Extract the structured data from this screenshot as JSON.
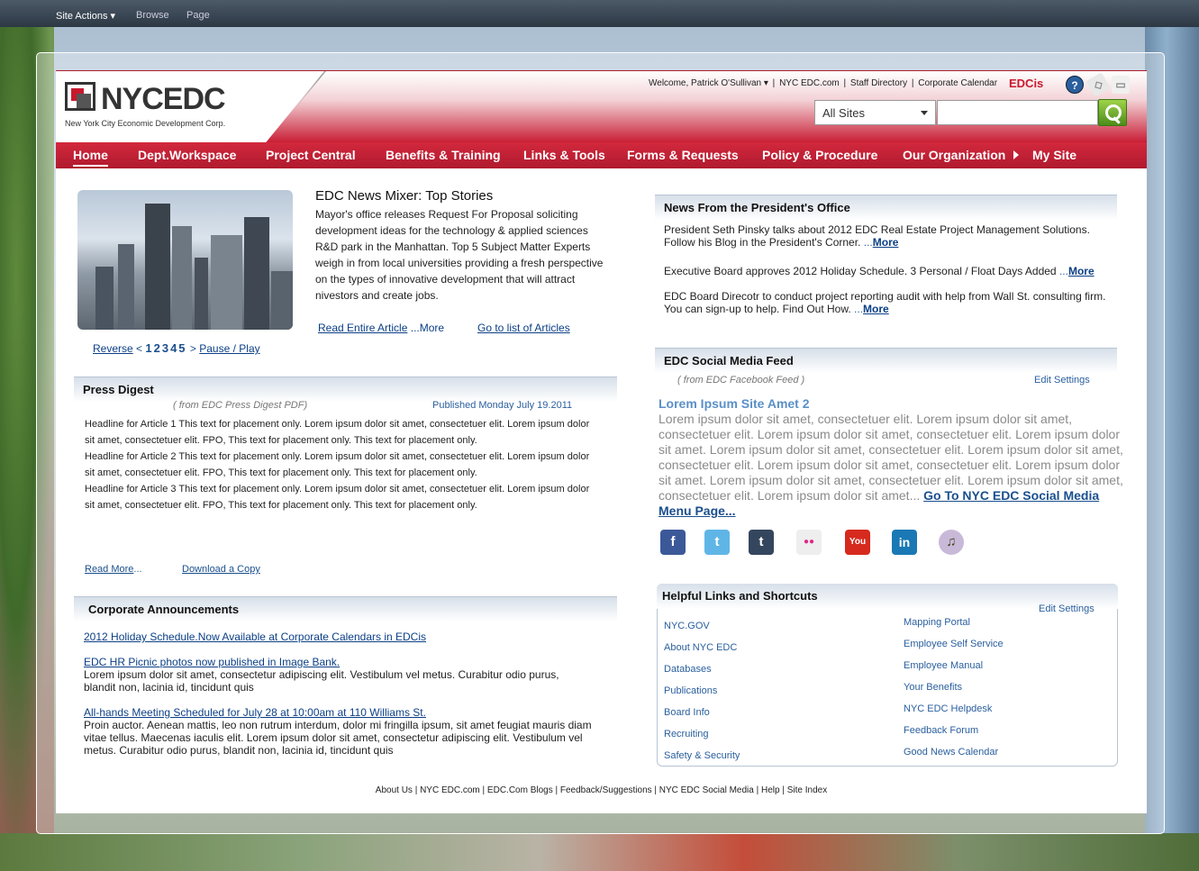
{
  "ribbon": {
    "site_actions": "Site Actions ▾",
    "browse": "Browse",
    "page": "Page"
  },
  "header": {
    "logo_text": "NYCEDC",
    "logo_sub": "New York City Economic Development Corp.",
    "welcome": "Welcome, Patrick O'Sullivan ▾",
    "links": [
      "NYC EDC.com",
      "Staff Directory",
      "Corporate Calendar"
    ],
    "edcis": "EDCis",
    "help_icon": "?",
    "scope": "All Sites",
    "search_placeholder": ""
  },
  "nav": [
    "Home",
    "Dept.Workspace",
    "Project Central",
    "Benefits & Training",
    "Links & Tools",
    "Forms & Requests",
    "Policy & Procedure",
    "Our Organization",
    "My Site"
  ],
  "news": {
    "title": "EDC News Mixer: Top Stories",
    "body": "Mayor's office releases Request For Proposal soliciting development ideas for the technology & applied sciences R&D park in the Manhattan. Top 5 Subject Matter Experts weigh in from local universities providing a fresh perspective on the types of innovative development that will attract nivestors and create jobs.",
    "read": "Read Entire Article",
    "more": "...More",
    "list": "Go to list of Articles",
    "reverse": "Reverse",
    "lt": "<",
    "pages": "12345",
    "gt": ">",
    "pause": "Pause / Play"
  },
  "press": {
    "title": "Press Digest",
    "source": "( from EDC Press Digest PDF)",
    "published": "Published Monday July 19.2011",
    "articles": [
      "Headline for Article 1 This text for placement only. Lorem ipsum dolor sit amet, consectetuer elit. Lorem ipsum dolor sit amet, consectetuer elit. FPO, This text for placement only. This text for placement only.",
      "Headline for Article 2 This text for placement only. Lorem ipsum dolor sit amet, consectetuer elit. Lorem ipsum dolor sit amet, consectetuer elit. FPO, This text for placement only. This text for placement only.",
      "Headline for Article 3 This text for placement only. Lorem ipsum dolor sit amet, consectetuer elit. Lorem ipsum dolor sit amet, consectetuer elit. FPO, This text for placement only. This text for placement only."
    ],
    "read_more": "Read More",
    "dots": "...",
    "download": "Download a Copy"
  },
  "announcements": {
    "title": "Corporate Announcements",
    "items": [
      {
        "link": "2012 Holiday Schedule.Now Available at Corporate Calendars in EDCis",
        "text": ""
      },
      {
        "link": "EDC HR Picnic photos now published in Image Bank.",
        "text": "Lorem ipsum dolor sit amet, consectetur adipiscing elit. Vestibulum vel metus. Curabitur odio purus, blandit non, lacinia id, tincidunt quis"
      },
      {
        "link": "All-hands Meeting Scheduled for July 28 at 10:00am at 110 Williams St.",
        "text": "Proin auctor. Aenean mattis, leo non rutrum interdum, dolor mi fringilla ipsum, sit amet feugiat mauris diam vitae tellus. Maecenas iaculis elit.  Lorem ipsum dolor sit amet, consectetur adipiscing elit. Vestibulum vel metus. Curabitur odio purus, blandit non, lacinia id, tincidunt quis"
      }
    ]
  },
  "president": {
    "title": "News From the President's Office",
    "items": [
      {
        "text": "President Seth Pinsky talks about 2012 EDC Real Estate Project Management Solutions. Follow his Blog in the President's Corner.",
        "more": "More"
      },
      {
        "text": "Executive Board approves 2012 Holiday Schedule.    3 Personal / Float Days Added",
        "more": "More"
      },
      {
        "text": "EDC Board Direcotr to conduct project reporting audit with help from Wall St. consulting firm. You can sign-up to help.  Find Out How.",
        "more": "More"
      }
    ],
    "dots": "..."
  },
  "social": {
    "title": "EDC Social Media Feed",
    "source": "( from EDC Facebook Feed )",
    "edit": "Edit Settings",
    "post_title": "Lorem Ipsum Site Amet 2",
    "post_body": "Lorem ipsum dolor sit amet, consectetuer elit. Lorem ipsum dolor sit amet, consectetuer elit. Lorem ipsum dolor sit amet, consectetuer elit. Lorem ipsum dolor sit amet.  Lorem ipsum dolor sit amet, consectetuer elit. Lorem ipsum dolor sit amet, consectetuer elit. Lorem ipsum dolor sit amet, consectetuer elit. Lorem ipsum dolor sit amet. Lorem ipsum dolor sit amet, consectetuer elit. Lorem ipsum dolor sit amet, consectetuer elit. Lorem ipsum dolor sit amet...",
    "goto": "Go To NYC EDC Social Media Menu Page...",
    "icons": {
      "facebook": "f",
      "twitter": "t",
      "tumblr": "t",
      "flickr": "●●",
      "youtube": "You",
      "linkedin": "in",
      "podcast": "♫"
    }
  },
  "helpful": {
    "title": "Helpful Links and Shortcuts",
    "edit": "Edit Settings",
    "left": [
      "NYC.GOV",
      "About NYC EDC",
      "Databases",
      "Publications",
      "Board Info",
      "Recruiting",
      "Safety & Security"
    ],
    "right": [
      "Mapping Portal",
      "Employee Self Service",
      "Employee Manual",
      "Your Benefits",
      "NYC EDC Helpdesk",
      "Feedback Forum",
      "Good News Calendar"
    ]
  },
  "footer": [
    "About Us",
    "NYC EDC.com",
    "EDC.Com Blogs",
    "Feedback/Suggestions",
    "NYC EDC Social Media",
    "Help",
    "Site Index"
  ],
  "colors": {
    "brand_red": "#c8192e",
    "link_blue": "#1a4f8e",
    "nav_red": "#b01a2e"
  }
}
